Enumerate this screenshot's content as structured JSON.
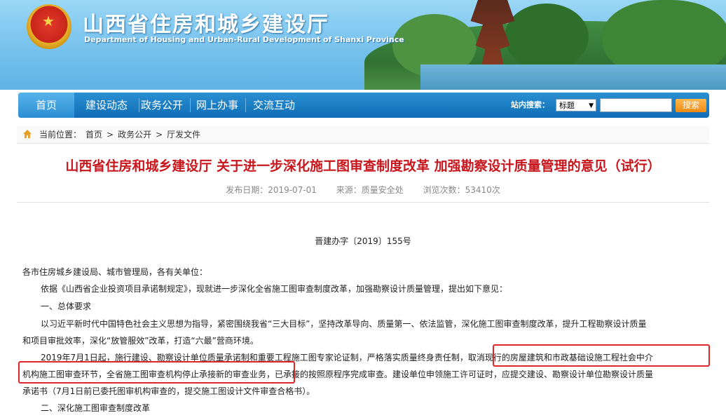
{
  "header": {
    "title": "山西省住房和城乡建设厅",
    "subtitle": "Department of Housing and Urban-Rural Development of Shanxi Province"
  },
  "nav": {
    "items": [
      "首页",
      "建设动态",
      "政务公开",
      "网上办事",
      "交流互动"
    ],
    "search_label": "站内搜索：",
    "search_field": "标题",
    "search_button": "搜索"
  },
  "breadcrumb": {
    "prefix": "当前位置：",
    "items": [
      "首页",
      ">",
      "政务公开",
      ">",
      "厅发文件"
    ]
  },
  "article": {
    "title": "山西省住房和城乡建设厅 关于进一步深化施工图审查制度改革 加强勘察设计质量管理的意见（试行）",
    "published": "发布日期：2019-07-01",
    "source": "来源：质量安全处",
    "views": "浏览次数：53410次",
    "doc_number": "晋建办字〔2019〕155号",
    "paragraphs": [
      "各市住房城乡建设局、城市管理局，各有关单位：",
      "依据《山西省企业投资项目承诺制规定》，现就进一步深化全省施工图审查制度改革，加强勘察设计质量管理，提出如下意见：",
      "一、总体要求",
      "以习近平新时代中国特色社会主义思想为指导，紧密围绕我省“三大目标”，坚持改革导向、质量第一、依法监管，深化施工图审查制度改革，提升工程勘察设计质量",
      "和项目审批效率，深化“放管服效”改革，打造“六最”营商环境。",
      "2019年7月1日起，施行建设、勘察设计单位质量承诺制和重要工程施工图专家论证制，严格落实质量终身责任制，取消现行的房屋建筑和市政基础设施工程社会中介",
      "机构施工图审查环节，全省施工图审查机构停止承接新的审查业务，已承接的按照原程序完成审查。建设单位申领施工许可证时，应提交建设、勘察设计单位勘察设计质量",
      "承诺书（7月1日前已委托图审机构审查的，提交施工图设计文件审查合格书）。",
      "二、深化施工图审查制度改革"
    ]
  },
  "colors": {
    "nav_blue": "#1577c0",
    "title_red": "#c8161d",
    "highlight_red": "#e0262b",
    "search_orange": "#ee8a12"
  }
}
